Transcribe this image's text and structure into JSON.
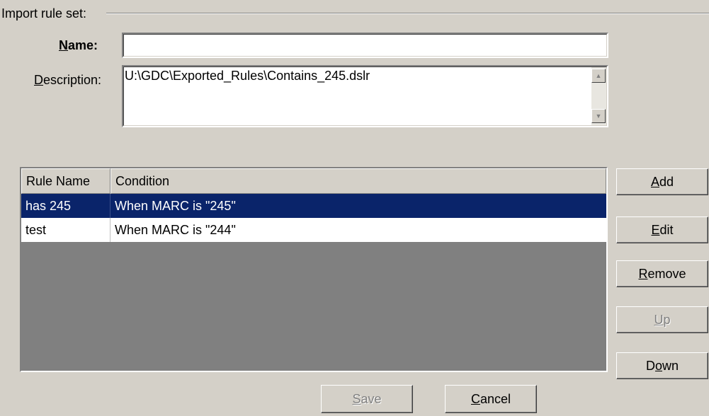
{
  "group": {
    "title": "Import rule set:"
  },
  "name_field": {
    "label_prefix": "",
    "label_mnemonic": "N",
    "label_rest": "ame:",
    "value": ""
  },
  "description_field": {
    "label_mnemonic": "D",
    "label_rest": "escription:",
    "value": "U:\\GDC\\Exported_Rules\\Contains_245.dslr"
  },
  "rules_table": {
    "columns": [
      "Rule Name",
      "Condition"
    ],
    "rows": [
      {
        "rule_name": "has 245",
        "condition": "When MARC is \"245\"",
        "selected": true
      },
      {
        "rule_name": "test",
        "condition": "When MARC is \"244\"",
        "selected": false
      }
    ]
  },
  "side_buttons": {
    "add": {
      "mnemonic": "A",
      "rest": "dd",
      "enabled": true
    },
    "edit": {
      "mnemonic": "E",
      "rest": "dit",
      "enabled": true
    },
    "remove": {
      "mnemonic": "R",
      "rest": "emove",
      "enabled": true
    },
    "up": {
      "mnemonic": "U",
      "rest": "p",
      "enabled": false
    },
    "down": {
      "pre": "D",
      "mnemonic": "o",
      "rest": "wn",
      "enabled": true
    }
  },
  "bottom_buttons": {
    "save": {
      "mnemonic": "S",
      "rest": "ave",
      "enabled": false
    },
    "cancel": {
      "mnemonic": "C",
      "rest": "ancel",
      "enabled": true
    }
  },
  "icons": {
    "scroll_up": "triangle-up",
    "scroll_down": "triangle-down"
  }
}
